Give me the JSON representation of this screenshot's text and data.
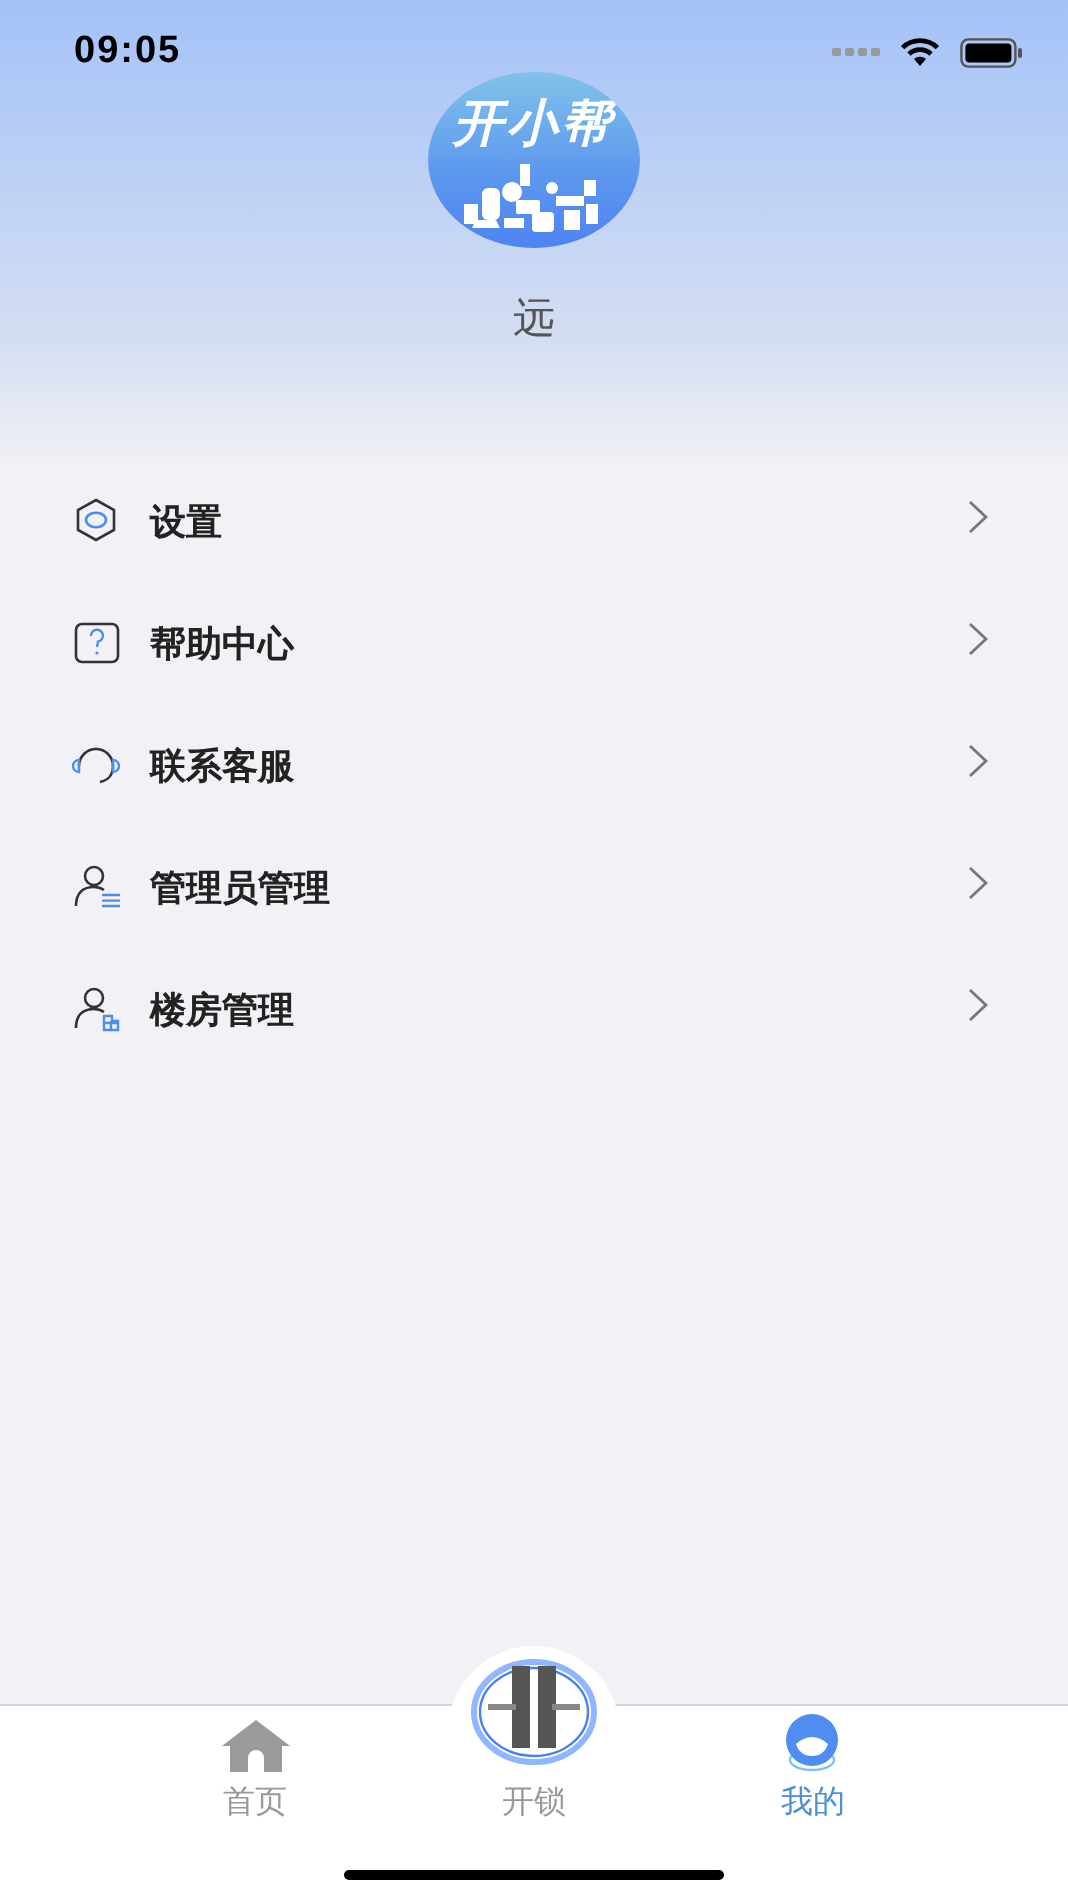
{
  "status_bar": {
    "time": "09:05"
  },
  "profile": {
    "logo_text": "开小帮",
    "name": "远"
  },
  "menu": [
    {
      "label": "设置"
    },
    {
      "label": "帮助中心"
    },
    {
      "label": "联系客服"
    },
    {
      "label": "管理员管理"
    },
    {
      "label": "楼房管理"
    }
  ],
  "tab_bar": [
    {
      "label": "首页",
      "selected": false
    },
    {
      "label": "开锁",
      "selected": false
    },
    {
      "label": "我的",
      "selected": true
    }
  ]
}
